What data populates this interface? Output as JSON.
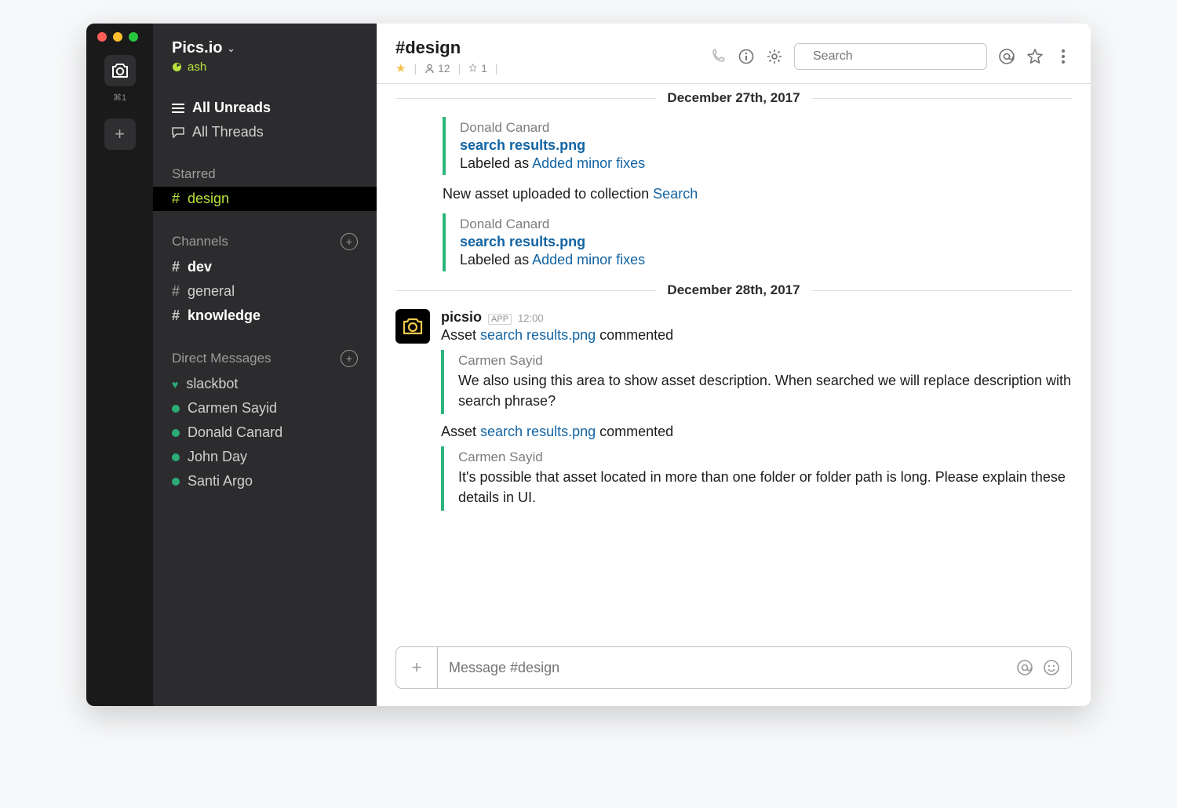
{
  "workspace": {
    "name": "Pics.io",
    "user": "ash",
    "shortcut": "⌘1"
  },
  "sidebar": {
    "all_unreads": "All Unreads",
    "all_threads": "All Threads",
    "starred_heading": "Starred",
    "starred": [
      {
        "name": "design",
        "active": true
      }
    ],
    "channels_heading": "Channels",
    "channels": [
      {
        "name": "dev",
        "unread": true
      },
      {
        "name": "general",
        "unread": false
      },
      {
        "name": "knowledge",
        "unread": true
      }
    ],
    "dm_heading": "Direct Messages",
    "dms": [
      {
        "name": "slackbot",
        "heart": true
      },
      {
        "name": "Carmen Sayid"
      },
      {
        "name": "Donald Canard"
      },
      {
        "name": "John Day"
      },
      {
        "name": "Santi Argo"
      }
    ]
  },
  "header": {
    "title": "#design",
    "members": "12",
    "pinned": "1",
    "search_placeholder": "Search"
  },
  "dates": {
    "d1": "December 27th, 2017",
    "d2": "December 28th, 2017"
  },
  "msg1": {
    "author": "Donald Canard",
    "file": "search results.png",
    "labeled_as": "Labeled as ",
    "label_link": "Added minor fixes"
  },
  "upload_line": {
    "text": "New asset uploaded to collection ",
    "link": "Search"
  },
  "msg2": {
    "author": "Donald Canard",
    "file": "search results.png",
    "labeled_as": "Labeled as ",
    "label_link": "Added minor fixes"
  },
  "bot": {
    "name": "picsio",
    "app_tag": "APP",
    "time": "12:00"
  },
  "asset_commented": {
    "prefix": "Asset ",
    "file": "search results.png",
    "suffix": " commented"
  },
  "c1": {
    "author": "Carmen Sayid",
    "body": "We also using this area to show asset description. When searched we will replace description with search phrase?"
  },
  "c2": {
    "author": "Carmen Sayid",
    "body": "It's possible that asset located in more than one folder or folder path is long. Please explain these details in UI."
  },
  "composer": {
    "placeholder": "Message #design"
  }
}
